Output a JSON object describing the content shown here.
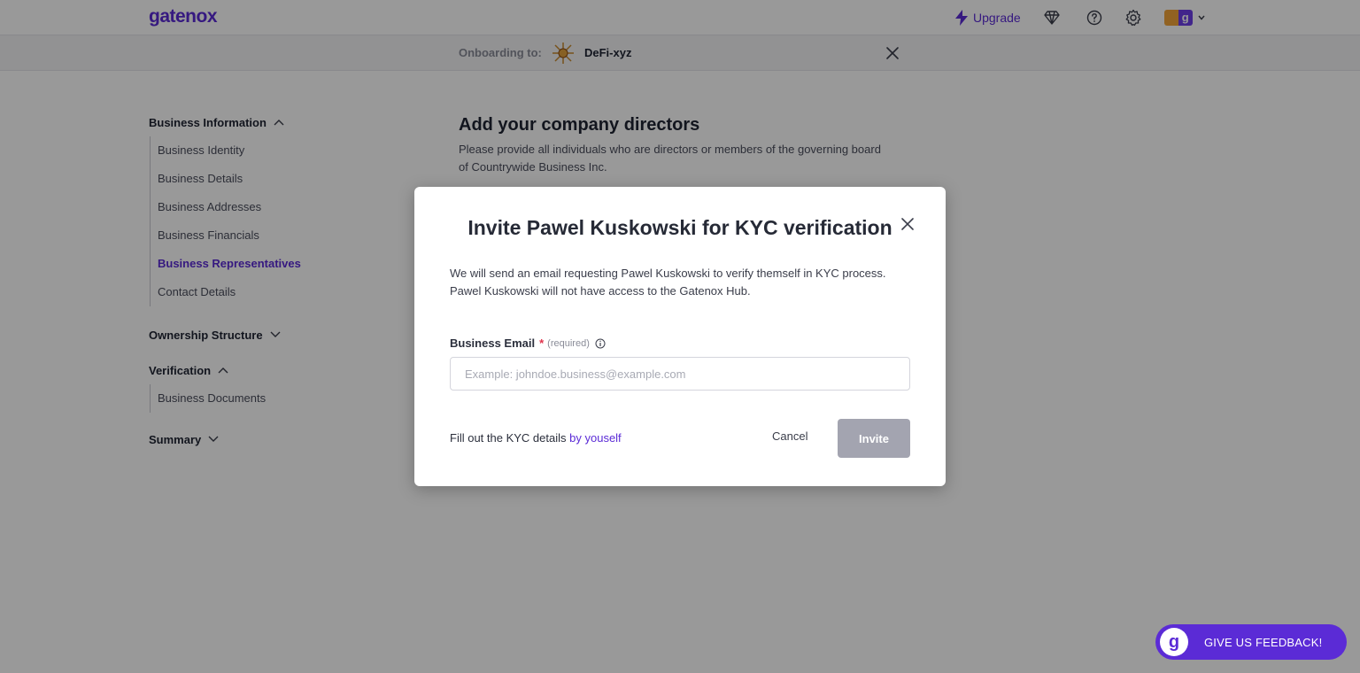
{
  "app": {
    "logo": "gatenox"
  },
  "topnav": {
    "upgrade_label": "Upgrade",
    "avatar_letter": "g"
  },
  "onboarding": {
    "label": "Onboarding to:",
    "company": "DeFi-xyz"
  },
  "sidebar": {
    "sections": [
      {
        "title": "Business Information",
        "expanded": true,
        "items": [
          "Business Identity",
          "Business Details",
          "Business Addresses",
          "Business Financials",
          "Business Representatives",
          "Contact Details"
        ]
      },
      {
        "title": "Ownership Structure",
        "expanded": false
      },
      {
        "title": "Verification",
        "expanded": true,
        "items": [
          "Business Documents"
        ]
      },
      {
        "title": "Summary",
        "expanded": false
      }
    ],
    "active_item": "Business Representatives"
  },
  "main": {
    "title": "Add your company directors",
    "description": "Please provide all individuals who are directors or members of the governing board of Countrywide Business Inc."
  },
  "modal": {
    "title": "Invite Pawel Kuskowski for KYC verification",
    "description": "We will send an email requesting Pawel Kuskowski to verify themself in KYC process. Pawel Kuskowski will not have access to the Gatenox Hub.",
    "email_label": "Business Email",
    "required_star": "*",
    "required_text": "(required)",
    "email_value": "",
    "email_placeholder": "Example: johndoe.business@example.com",
    "self_fill_prefix": "Fill out the KYC details",
    "self_fill_link": "by youself",
    "cancel_label": "Cancel",
    "invite_label": "Invite"
  },
  "feedback": {
    "label": "GIVE US FEEDBACK!",
    "logo_letter": "g"
  },
  "colors": {
    "brand": "#5b2bd6",
    "invite_disabled": "#a3a4b0",
    "required": "#e0324b"
  }
}
